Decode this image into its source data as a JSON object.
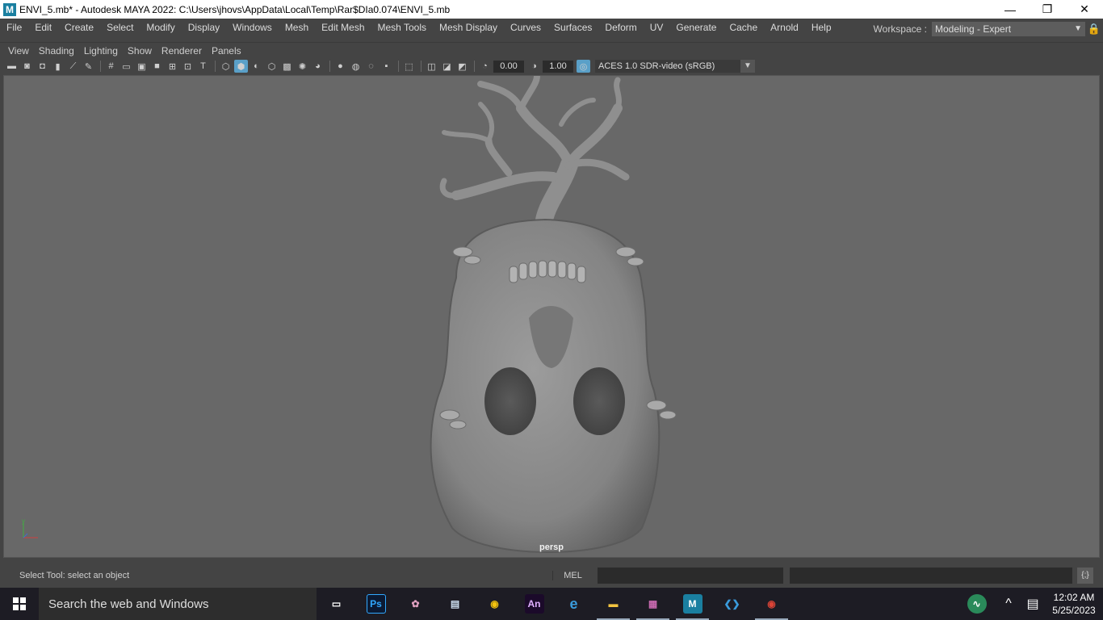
{
  "window": {
    "title": "ENVI_5.mb* - Autodesk MAYA 2022: C:\\Users\\jhovs\\AppData\\Local\\Temp\\Rar$DIa0.074\\ENVI_5.mb",
    "app_logo": "M"
  },
  "menus": [
    "File",
    "Edit",
    "Create",
    "Select",
    "Modify",
    "Display",
    "Windows",
    "Mesh",
    "Edit Mesh",
    "Mesh Tools",
    "Mesh Display",
    "Curves",
    "Surfaces",
    "Deform",
    "UV",
    "Generate",
    "Cache",
    "Arnold",
    "Help"
  ],
  "workspace": {
    "label": "Workspace :",
    "value": "Modeling - Expert"
  },
  "panel_menus": [
    "View",
    "Shading",
    "Lighting",
    "Show",
    "Renderer",
    "Panels"
  ],
  "toolbar": {
    "exposure": "0.00",
    "gamma": "1.00",
    "colorspace": "ACES 1.0 SDR-video (sRGB)"
  },
  "viewport": {
    "camera_label": "persp",
    "background": "#686868"
  },
  "status": {
    "help_line": "Select Tool: select an object",
    "mel_label": "MEL"
  },
  "taskbar": {
    "search_placeholder": "Search the web and Windows",
    "apps": [
      {
        "name": "task-view",
        "label": "▭"
      },
      {
        "name": "photoshop",
        "label": "Ps"
      },
      {
        "name": "tool-app",
        "label": "✿"
      },
      {
        "name": "news-app",
        "label": "▤"
      },
      {
        "name": "chrome",
        "label": "◉"
      },
      {
        "name": "animate",
        "label": "An"
      },
      {
        "name": "edge",
        "label": "e"
      },
      {
        "name": "file-explorer",
        "label": "▬"
      },
      {
        "name": "winrar",
        "label": "▦"
      },
      {
        "name": "maya",
        "label": "M"
      },
      {
        "name": "vscode",
        "label": "❮❯"
      },
      {
        "name": "chrome-2",
        "label": "◉"
      }
    ],
    "time": "12:02 AM",
    "date": "5/25/2023"
  }
}
